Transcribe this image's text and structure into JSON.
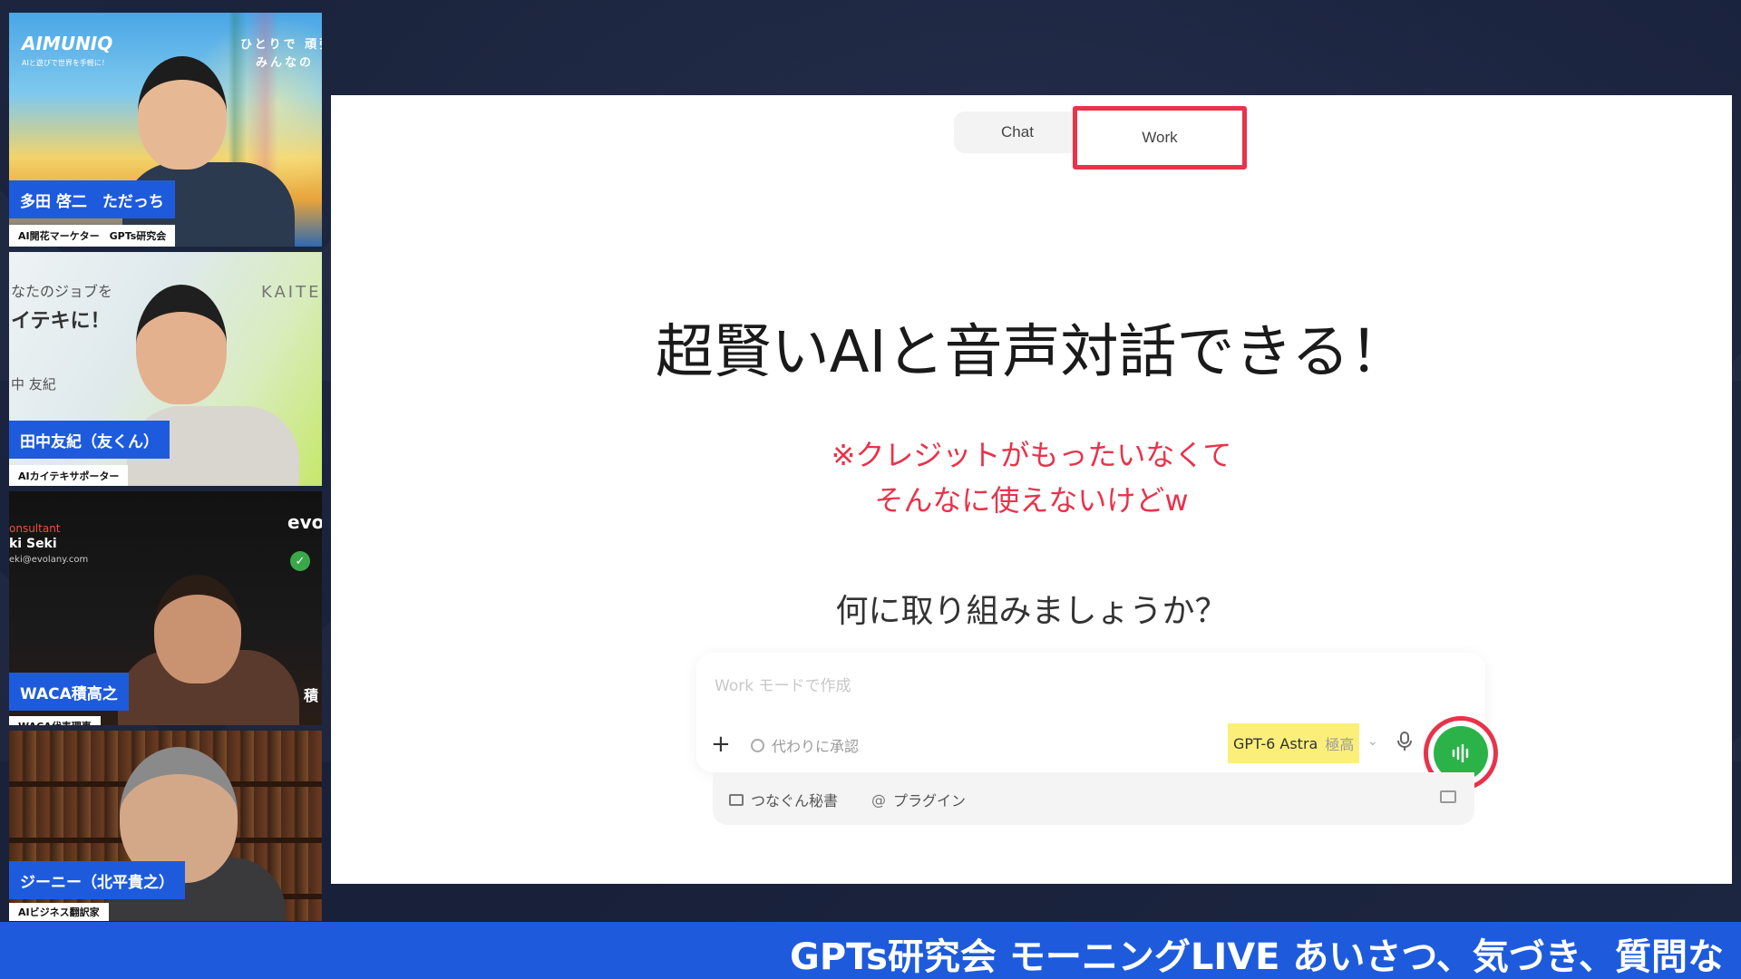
{
  "participants": [
    {
      "name": "多田 啓二　ただっち",
      "role": "AI開花マーケター　GPTs研究会",
      "backdrop_texts": [
        "AIMUNIQ",
        "AIと遊びで世界を手軽に！",
        "ひとりで 頑張",
        "みんなの"
      ]
    },
    {
      "name": "田中友紀（友くん）",
      "role": "AIカイテキサポーター",
      "backdrop_texts": [
        "なたのジョブを",
        "イテキに！",
        "KAITE",
        "中 友紀"
      ]
    },
    {
      "name": "WACA積高之",
      "role": "WACA代表理事",
      "backdrop_texts": [
        "onsultant",
        "ki Seki",
        "eki@evolany.com",
        "evo",
        "積"
      ]
    },
    {
      "name": "ジーニー（北平貴之）",
      "role": "AIビジネス翻訳家",
      "backdrop_texts": []
    }
  ],
  "slide": {
    "tabs": [
      {
        "label": "Chat"
      },
      {
        "label": "Work"
      }
    ],
    "headline": "超賢いAIと音声対話できる！",
    "note_lines": [
      "※クレジットがもったいなくて",
      "そんなに使えないけどw"
    ],
    "question": "何に取り組みましょうか？",
    "composer": {
      "placeholder": "Work モードで作成",
      "plus_label": "+",
      "approve_label": "代わりに承認",
      "model_name": "GPT-6 Astra",
      "model_level": "極高",
      "tool_1": "つなぐん秘書",
      "tool_2": "プラグイン"
    }
  },
  "ticker": "GPTs研究会 モーニングLIVE あいさつ、気づき、質問な",
  "colors": {
    "accent_red": "#e8334a",
    "brand_blue": "#1e5bdc",
    "voice_green": "#2bb34a",
    "highlight_yellow": "#fbef7a"
  }
}
